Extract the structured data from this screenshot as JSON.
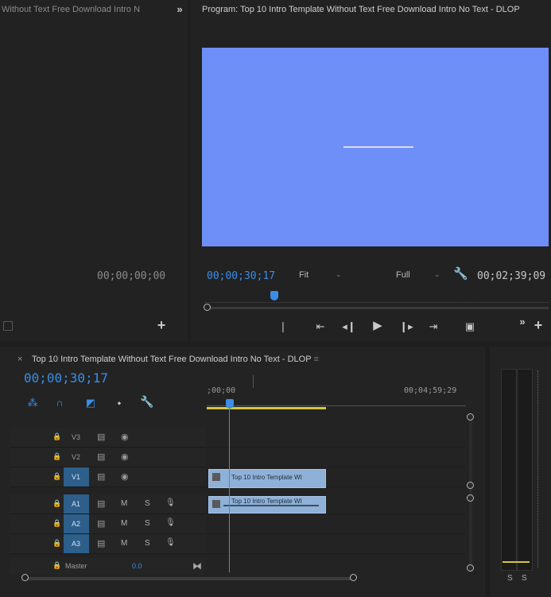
{
  "source_monitor": {
    "tab_title": "Without Text Free Download Intro N",
    "overflow": "»",
    "timecode": "00;00;00;00",
    "add": "+"
  },
  "program_monitor": {
    "tab_title": "Program: Top 10 Intro Template Without Text Free Download Intro No Text - DLOP",
    "timecode_current": "00;00;30;17",
    "zoom": "Fit",
    "resolution": "Full",
    "timecode_duration": "00;02;39;09",
    "preview_bg": "#6e8ff7",
    "playhead_fraction": 0.19,
    "overflow": "»",
    "add": "+"
  },
  "timeline": {
    "close": "×",
    "title": "Top 10 Intro Template Without Text Free Download Intro No Text - DLOP",
    "menu": "≡",
    "timecode": "00;00;30;17",
    "ruler_start": ";00;00",
    "ruler_end": "00;04;59;29",
    "video_tracks": [
      {
        "name": "V3"
      },
      {
        "name": "V2"
      },
      {
        "name": "V1",
        "selected": true
      }
    ],
    "audio_tracks": [
      {
        "name": "A1",
        "m": "M",
        "s": "S"
      },
      {
        "name": "A2",
        "m": "M",
        "s": "S"
      },
      {
        "name": "A3",
        "m": "M",
        "s": "S"
      }
    ],
    "master": {
      "label": "Master",
      "value": "0.0"
    },
    "clip_video": "Top 10 Intro Template WI",
    "clip_audio": "Top 10 Intro Template WI"
  },
  "audio_meter": {
    "s1": "S",
    "s2": "S"
  }
}
